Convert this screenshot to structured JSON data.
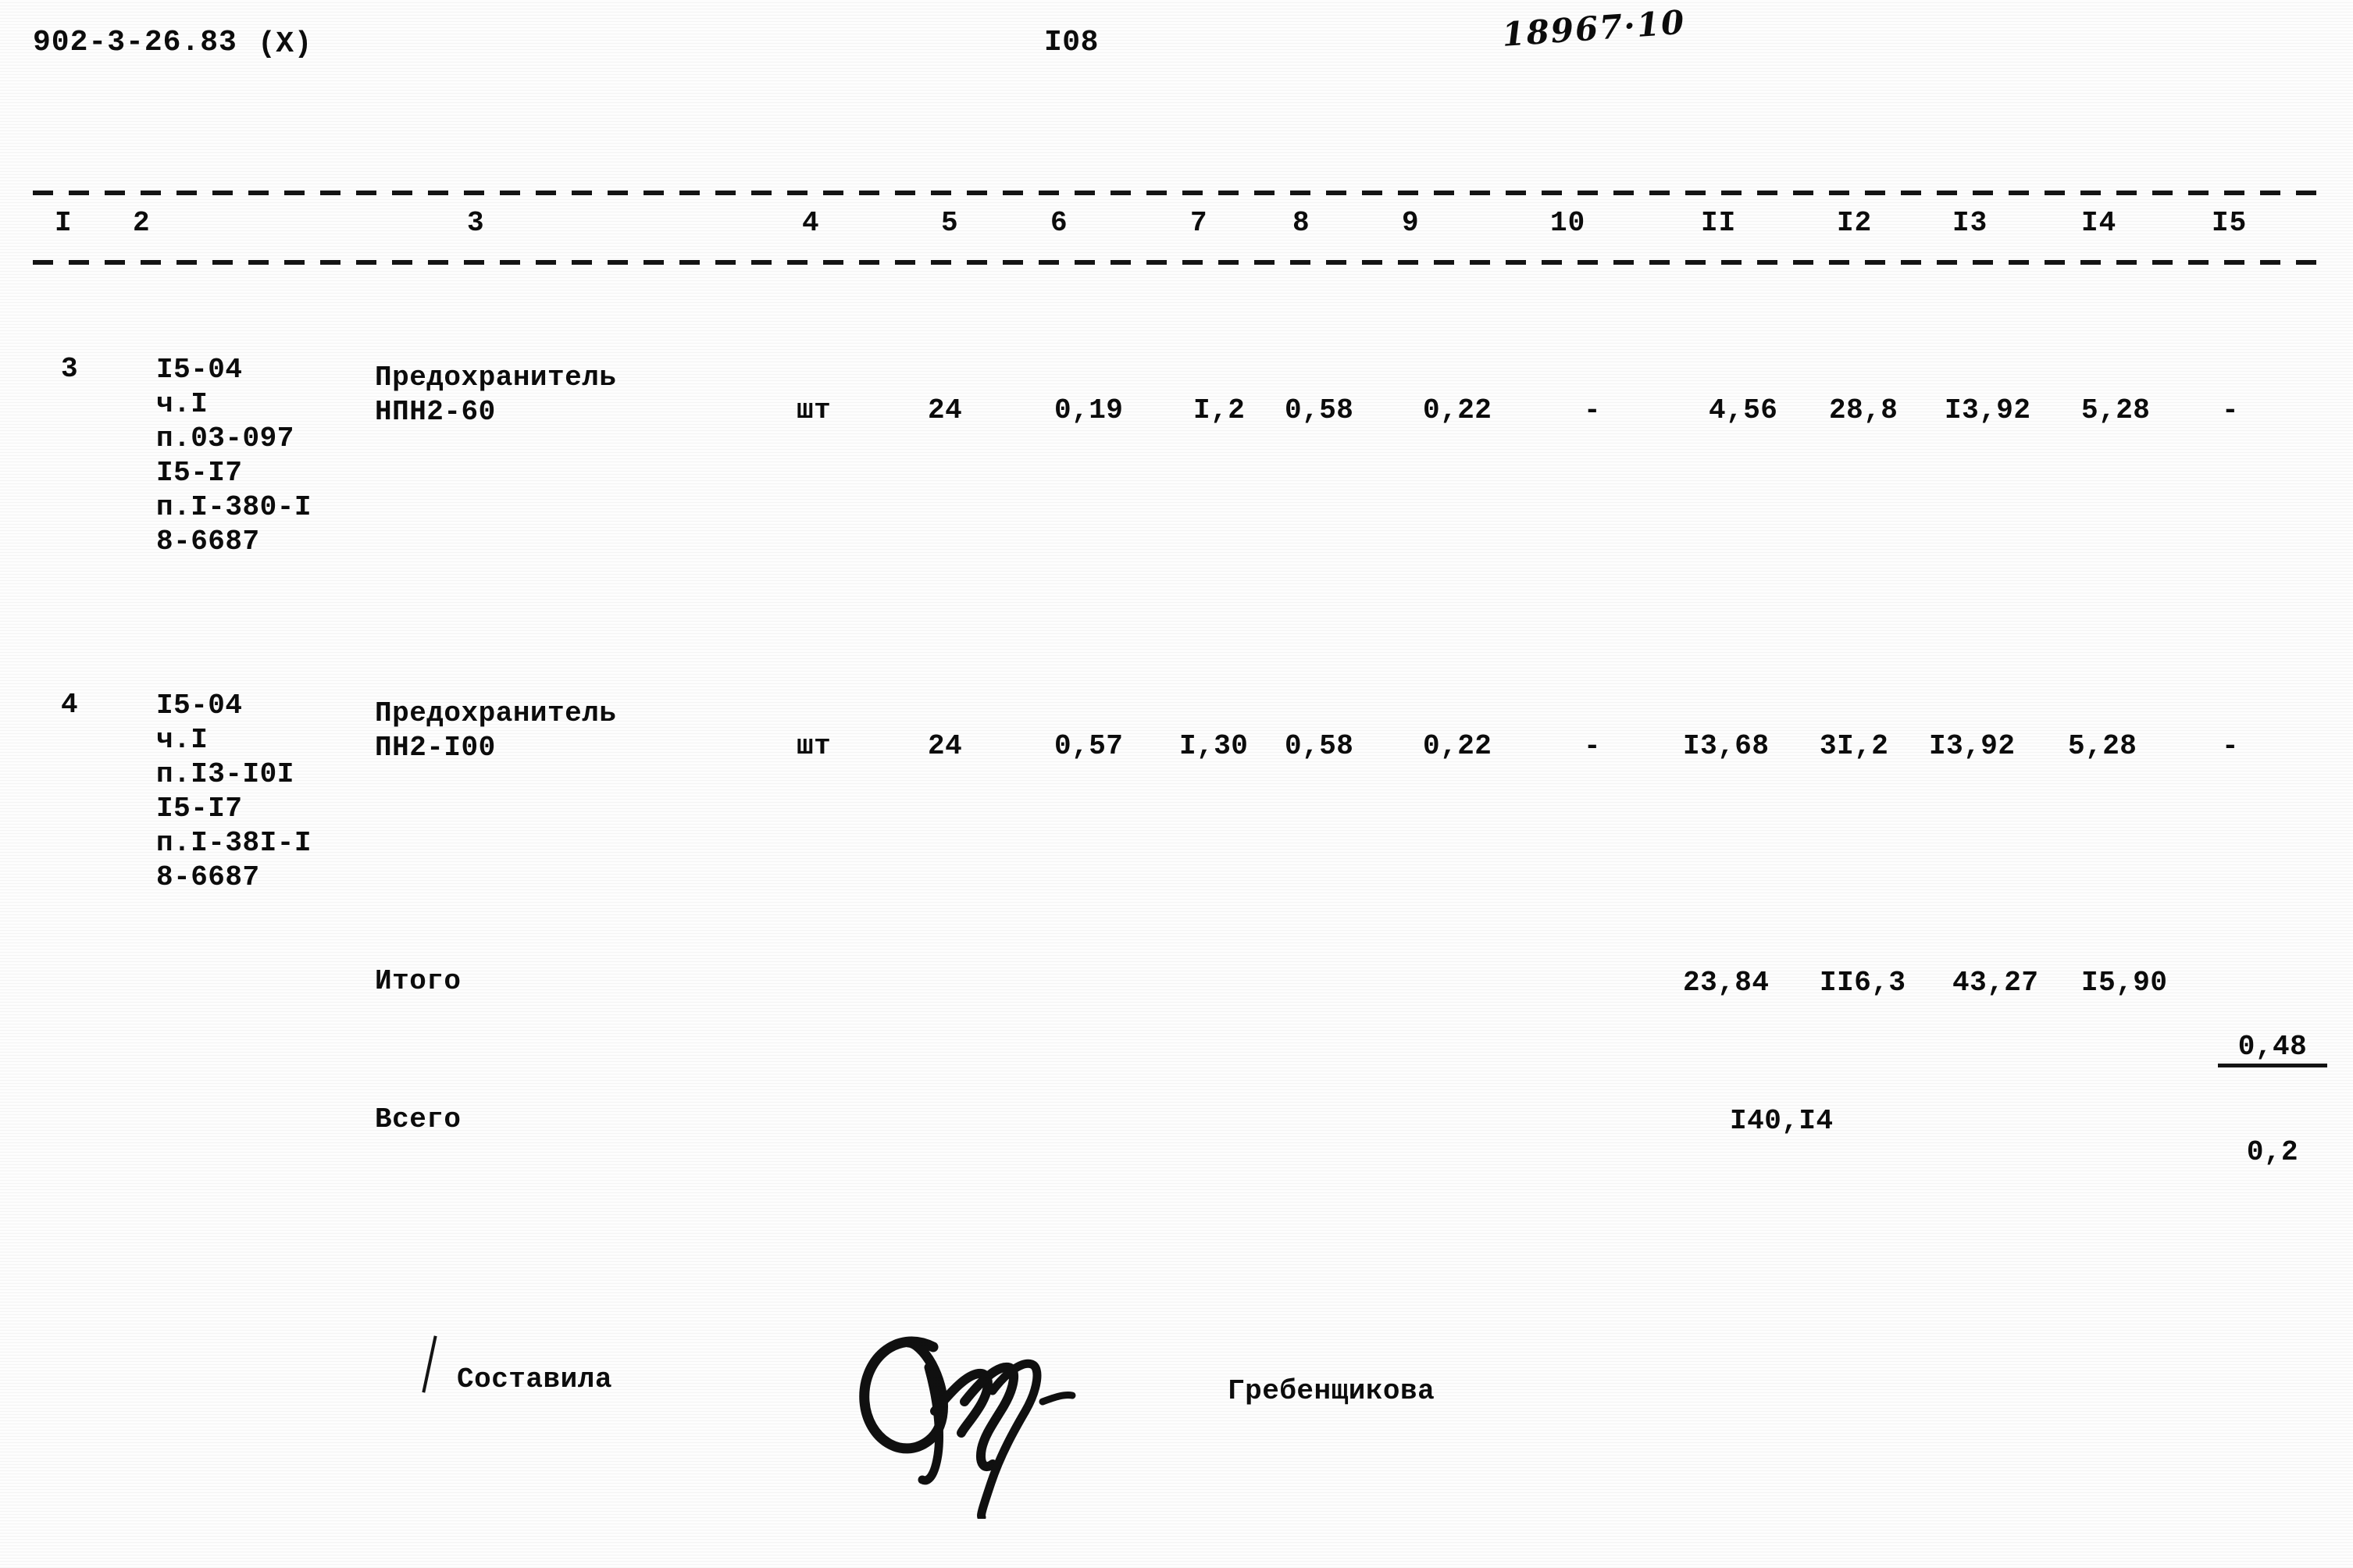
{
  "document": {
    "code": "902-3-26.83",
    "marker": "(X)",
    "page_number": "I08",
    "handwritten_note": "18967·10"
  },
  "table": {
    "column_headers": [
      "I",
      "2",
      "3",
      "4",
      "5",
      "6",
      "7",
      "8",
      "9",
      "10",
      "II",
      "I2",
      "I3",
      "I4",
      "I5"
    ],
    "rows": [
      {
        "num": "3",
        "codes": "I5-04\nч.I\nп.03-097\nI5-I7\nп.I-380-I\n8-6687",
        "name": "Предохранитель\nНПН2-60",
        "unit": "шт",
        "qty": "24",
        "c6": "0,19",
        "c7": "I,2",
        "c8": "0,58",
        "c9": "0,22",
        "c10": "-",
        "c11": "4,56",
        "c12": "28,8",
        "c13": "I3,92",
        "c14": "5,28",
        "c15": "-"
      },
      {
        "num": "4",
        "codes": "I5-04\nч.I\nп.I3-I0I\nI5-I7\nп.I-38I-I\n8-6687",
        "name": "Предохранитель\nПН2-I00",
        "unit": "шт",
        "qty": "24",
        "c6": "0,57",
        "c7": "I,30",
        "c8": "0,58",
        "c9": "0,22",
        "c10": "-",
        "c11": "I3,68",
        "c12": "3I,2",
        "c13": "I3,92",
        "c14": "5,28",
        "c15": "-"
      }
    ],
    "subtotal": {
      "label": "Итого",
      "c11": "23,84",
      "c12": "II6,3",
      "c13": "43,27",
      "c14": "I5,90",
      "c15_top": "0,48",
      "c15_bottom": "0,2"
    },
    "total": {
      "label": "Всего",
      "value": "I40,I4"
    }
  },
  "footer": {
    "compiled_by_label": "Составила",
    "compiled_by_name": "Гребенщикова"
  }
}
